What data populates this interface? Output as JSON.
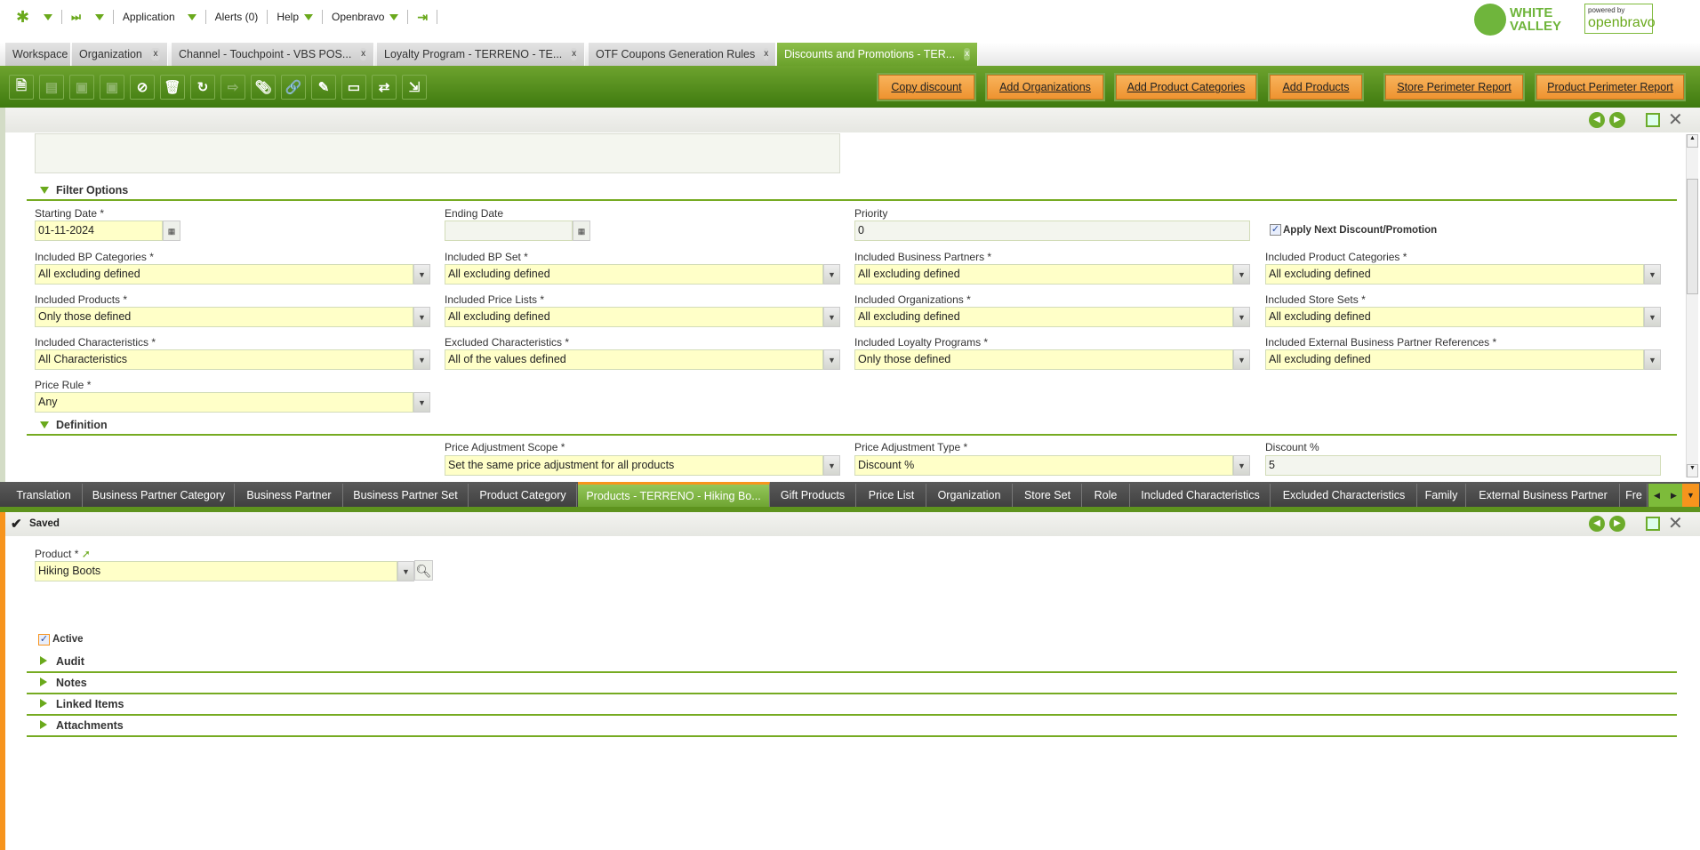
{
  "topnav": {
    "application": "Application",
    "alerts": "Alerts (0)",
    "help": "Help",
    "user": "Openbravo"
  },
  "logos": {
    "white_valley": "WHITE VALLEY",
    "powered_by": "powered by",
    "openbravo": "openbravo"
  },
  "window_tabs": [
    {
      "label": "Workspace",
      "closable": false
    },
    {
      "label": "Organization",
      "closable": true
    },
    {
      "label": "Channel - Touchpoint - VBS POS...",
      "closable": true
    },
    {
      "label": "Loyalty Program - TERRENO - TE...",
      "closable": true
    },
    {
      "label": "OTF Coupons Generation Rules",
      "closable": true
    },
    {
      "label": "Discounts and Promotions - TER...",
      "closable": true,
      "active": true
    }
  ],
  "close_glyph": "x",
  "toolbar": {
    "icons": [
      "new-document",
      "grid-view",
      "save",
      "save-and-close",
      "undo",
      "delete",
      "refresh",
      "export",
      "attachment",
      "link",
      "audit-trail",
      "layout-toggle",
      "clone",
      "print"
    ],
    "buttons": [
      "Copy discount",
      "Add Organizations",
      "Add Product Categories",
      "Add Products",
      "Store Perimeter Report",
      "Product Perimeter Report"
    ]
  },
  "form": {
    "filter_section": "Filter Options",
    "definition_section": "Definition",
    "starting_date": {
      "label": "Starting Date *",
      "value": "01-11-2024"
    },
    "ending_date": {
      "label": "Ending Date",
      "value": ""
    },
    "priority": {
      "label": "Priority",
      "value": "0"
    },
    "apply_next": {
      "label": "Apply Next Discount/Promotion",
      "checked": true
    },
    "selects": [
      {
        "label": "Included BP Categories *",
        "value": "All excluding defined"
      },
      {
        "label": "Included BP Set *",
        "value": "All excluding defined"
      },
      {
        "label": "Included Business Partners *",
        "value": "All excluding defined"
      },
      {
        "label": "Included Product Categories *",
        "value": "All excluding defined"
      },
      {
        "label": "Included Products *",
        "value": "Only those defined"
      },
      {
        "label": "Included Price Lists *",
        "value": "All excluding defined"
      },
      {
        "label": "Included Organizations *",
        "value": "All excluding defined"
      },
      {
        "label": "Included Store Sets *",
        "value": "All excluding defined"
      },
      {
        "label": "Included Characteristics *",
        "value": "All Characteristics"
      },
      {
        "label": "Excluded Characteristics *",
        "value": "All of the values defined"
      },
      {
        "label": "Included Loyalty Programs *",
        "value": "Only those defined"
      },
      {
        "label": "Included External Business Partner References *",
        "value": "All excluding defined"
      },
      {
        "label": "Price Rule *",
        "value": "Any"
      }
    ],
    "price_adjustment_scope": {
      "label": "Price Adjustment Scope *",
      "value": "Set the same price adjustment for all products"
    },
    "price_adjustment_type": {
      "label": "Price Adjustment Type *",
      "value": "Discount %"
    },
    "discount_pct": {
      "label": "Discount %",
      "value": "5"
    }
  },
  "child_tabs": [
    "Translation",
    "Business Partner Category",
    "Business Partner",
    "Business Partner Set",
    "Product Category",
    "Products - TERRENO - Hiking Bo...",
    "Gift Products",
    "Price List",
    "Organization",
    "Store Set",
    "Role",
    "Included Characteristics",
    "Excluded Characteristics",
    "Family",
    "External Business Partner",
    "Fre"
  ],
  "child_active_index": 5,
  "child": {
    "status": "Saved",
    "product": {
      "label": "Product *",
      "value": "Hiking Boots"
    },
    "active": {
      "label": "Active",
      "checked": true
    },
    "sections": [
      "Audit",
      "Notes",
      "Linked Items",
      "Attachments"
    ]
  }
}
